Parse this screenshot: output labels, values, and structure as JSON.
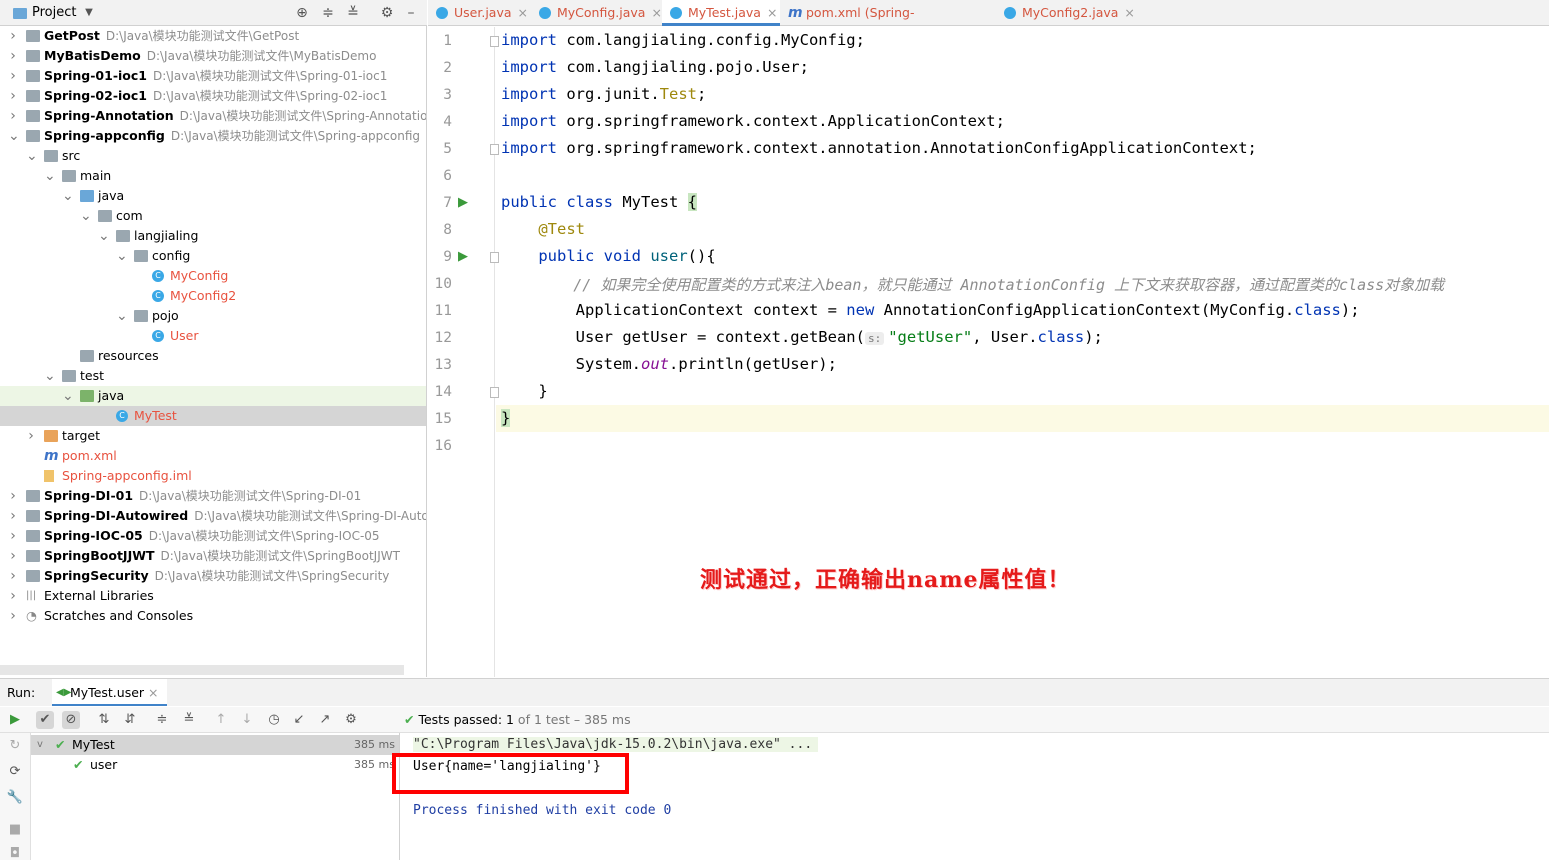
{
  "project": {
    "title": "Project",
    "tree": [
      {
        "name": "GetPost",
        "path": "D:\\Java\\模块功能测试文件\\GetPost",
        "depth": 0,
        "arrow": ">",
        "kind": "module",
        "bold": true
      },
      {
        "name": "MyBatisDemo",
        "path": "D:\\Java\\模块功能测试文件\\MyBatisDemo",
        "depth": 0,
        "arrow": ">",
        "kind": "module",
        "bold": true
      },
      {
        "name": "Spring-01-ioc1",
        "path": "D:\\Java\\模块功能测试文件\\Spring-01-ioc1",
        "depth": 0,
        "arrow": ">",
        "kind": "module",
        "bold": true
      },
      {
        "name": "Spring-02-ioc1",
        "path": "D:\\Java\\模块功能测试文件\\Spring-02-ioc1",
        "depth": 0,
        "arrow": ">",
        "kind": "module",
        "bold": true
      },
      {
        "name": "Spring-Annotation",
        "path": "D:\\Java\\模块功能测试文件\\Spring-Annotation",
        "depth": 0,
        "arrow": ">",
        "kind": "module",
        "bold": true
      },
      {
        "name": "Spring-appconfig",
        "path": "D:\\Java\\模块功能测试文件\\Spring-appconfig",
        "depth": 0,
        "arrow": "v",
        "kind": "module",
        "bold": true
      },
      {
        "name": "src",
        "path": "",
        "depth": 1,
        "arrow": "v",
        "kind": "folder"
      },
      {
        "name": "main",
        "path": "",
        "depth": 2,
        "arrow": "v",
        "kind": "folder"
      },
      {
        "name": "java",
        "path": "",
        "depth": 3,
        "arrow": "v",
        "kind": "folder-blue"
      },
      {
        "name": "com",
        "path": "",
        "depth": 4,
        "arrow": "v",
        "kind": "folder"
      },
      {
        "name": "langjialing",
        "path": "",
        "depth": 5,
        "arrow": "v",
        "kind": "folder"
      },
      {
        "name": "config",
        "path": "",
        "depth": 6,
        "arrow": "v",
        "kind": "folder"
      },
      {
        "name": "MyConfig",
        "path": "",
        "depth": 7,
        "arrow": "",
        "kind": "class",
        "red": true
      },
      {
        "name": "MyConfig2",
        "path": "",
        "depth": 7,
        "arrow": "",
        "kind": "class",
        "red": true
      },
      {
        "name": "pojo",
        "path": "",
        "depth": 6,
        "arrow": "v",
        "kind": "folder"
      },
      {
        "name": "User",
        "path": "",
        "depth": 7,
        "arrow": "",
        "kind": "class",
        "red": true
      },
      {
        "name": "resources",
        "path": "",
        "depth": 3,
        "arrow": "",
        "kind": "folder"
      },
      {
        "name": "test",
        "path": "",
        "depth": 2,
        "arrow": "v",
        "kind": "folder"
      },
      {
        "name": "java",
        "path": "",
        "depth": 3,
        "arrow": "v",
        "kind": "folder-green",
        "hl": true
      },
      {
        "name": "MyTest",
        "path": "",
        "depth": 5,
        "arrow": "",
        "kind": "class",
        "red": true,
        "sel": true
      },
      {
        "name": "target",
        "path": "",
        "depth": 1,
        "arrow": ">",
        "kind": "folder-orange"
      },
      {
        "name": "pom.xml",
        "path": "",
        "depth": 1,
        "arrow": "",
        "kind": "maven",
        "red": true
      },
      {
        "name": "Spring-appconfig.iml",
        "path": "",
        "depth": 1,
        "arrow": "",
        "kind": "file",
        "red": true
      },
      {
        "name": "Spring-DI-01",
        "path": "D:\\Java\\模块功能测试文件\\Spring-DI-01",
        "depth": 0,
        "arrow": ">",
        "kind": "module",
        "bold": true
      },
      {
        "name": "Spring-DI-Autowired",
        "path": "D:\\Java\\模块功能测试文件\\Spring-DI-Autowi",
        "depth": 0,
        "arrow": ">",
        "kind": "module",
        "bold": true
      },
      {
        "name": "Spring-IOC-05",
        "path": "D:\\Java\\模块功能测试文件\\Spring-IOC-05",
        "depth": 0,
        "arrow": ">",
        "kind": "module",
        "bold": true
      },
      {
        "name": "SpringBootJJWT",
        "path": "D:\\Java\\模块功能测试文件\\SpringBootJJWT",
        "depth": 0,
        "arrow": ">",
        "kind": "module",
        "bold": true
      },
      {
        "name": "SpringSecurity",
        "path": "D:\\Java\\模块功能测试文件\\SpringSecurity",
        "depth": 0,
        "arrow": ">",
        "kind": "module",
        "bold": true
      },
      {
        "name": "External Libraries",
        "path": "",
        "depth": 0,
        "arrow": ">",
        "kind": "lib"
      },
      {
        "name": "Scratches and Consoles",
        "path": "",
        "depth": 0,
        "arrow": ">",
        "kind": "scratch"
      }
    ]
  },
  "tabs": [
    {
      "label": "User.java"
    },
    {
      "label": "MyConfig.java"
    },
    {
      "label": "MyTest.java",
      "active": true
    },
    {
      "label": "pom.xml (Spring-appconfig)"
    },
    {
      "label": "MyConfig2.java"
    }
  ],
  "tab_close": "×",
  "editor": {
    "line_numbers": [
      "1",
      "2",
      "3",
      "4",
      "5",
      "6",
      "7",
      "8",
      "9",
      "10",
      "11",
      "12",
      "13",
      "14",
      "15",
      "16"
    ],
    "lines": {
      "l1": {
        "kw": "import",
        "rest": " com.langjialing.config.MyConfig;"
      },
      "l2": {
        "kw": "import",
        "rest": " com.langjialing.pojo.User;"
      },
      "l3": {
        "kw": "import",
        "rest": " org.junit.",
        "ann": "Test",
        "end": ";"
      },
      "l4": {
        "kw": "import",
        "rest": " org.springframework.context.ApplicationContext;"
      },
      "l5": {
        "kw": "import",
        "rest": " org.springframework.context.annotation.AnnotationConfigApplicationContext;"
      },
      "l7": {
        "kw1": "public",
        "kw2": "class",
        "rest": " MyTest ",
        "brace": "{"
      },
      "l8": {
        "ann": "@Test"
      },
      "l9": {
        "kw1": "public",
        "kw2": "void",
        "name": "user",
        "rest": "(){"
      },
      "l10": {
        "comment": "// 如果完全使用配置类的方式来注入bean，就只能通过 AnnotationConfig 上下文来获取容器，通过配置类的class对象加载"
      },
      "l11": {
        "a": "ApplicationContext context = ",
        "kw": "new",
        "b": " AnnotationConfigApplicationContext(MyConfig.",
        "kw2": "class",
        "c": ");"
      },
      "l12": {
        "a": "User getUser = context.getBean(",
        "hint": "s:",
        "str": "\"getUser\"",
        "b": ", User.",
        "kw": "class",
        "c": ");"
      },
      "l13": {
        "a": "System.",
        "fld": "out",
        "b": ".println(getUser);"
      },
      "l14": {
        "a": "}"
      },
      "l15": {
        "a": "}"
      }
    },
    "banner": "测试通过，正确输出name属性值！"
  },
  "run": {
    "label": "Run:",
    "tab": "MyTest.user",
    "status_prefix": "Tests passed: ",
    "status_count": "1",
    "status_suffix": " of 1 test – 385 ms",
    "tree": [
      {
        "name": "MyTest",
        "time": "385 ms"
      },
      {
        "name": "user",
        "time": "385 ms"
      }
    ],
    "console": [
      "\"C:\\Program Files\\Java\\jdk-15.0.2\\bin\\java.exe\" ...",
      "User{name='langjialing'}",
      "",
      "Process finished with exit code 0"
    ]
  },
  "colors": {
    "accent": "#4083c9",
    "error_red": "#e8523f",
    "pass_green": "#4caf50",
    "banner_red": "#e51a1a"
  }
}
